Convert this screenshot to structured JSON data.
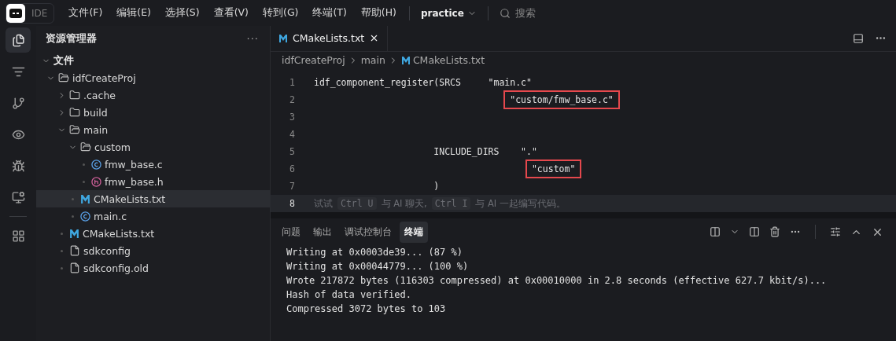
{
  "menubar": {
    "logo_label": "IDE",
    "menus": [
      "文件(F)",
      "编辑(E)",
      "选择(S)",
      "查看(V)",
      "转到(G)",
      "终端(T)",
      "帮助(H)"
    ],
    "workspace": "practice",
    "search": "搜索"
  },
  "activity_bar": [
    {
      "kind": "files",
      "selected": true
    },
    {
      "kind": "search",
      "selected": false
    },
    {
      "kind": "git",
      "selected": false
    },
    {
      "kind": "eye",
      "selected": false
    },
    {
      "kind": "bug",
      "selected": false
    },
    {
      "kind": "monitor",
      "selected": false
    },
    {
      "kind": "grid",
      "selected": false
    }
  ],
  "sidebar": {
    "title": "资源管理器",
    "more": "···",
    "section": "文件",
    "tree": [
      {
        "label": "idfCreateProj",
        "kind": "folder",
        "expanded": true,
        "selected": false,
        "children": [
          {
            "label": ".cache",
            "kind": "folder",
            "expanded": false,
            "selected": false
          },
          {
            "label": "build",
            "kind": "folder",
            "expanded": false,
            "selected": false
          },
          {
            "label": "main",
            "kind": "folder",
            "expanded": true,
            "selected": false,
            "children": [
              {
                "label": "custom",
                "kind": "folder",
                "expanded": true,
                "selected": false,
                "children": [
                  {
                    "label": "fmw_base.c",
                    "kind": "c",
                    "selected": false
                  },
                  {
                    "label": "fmw_base.h",
                    "kind": "h",
                    "selected": false
                  }
                ]
              },
              {
                "label": "CMakeLists.txt",
                "kind": "cmake",
                "selected": true
              },
              {
                "label": "main.c",
                "kind": "c",
                "selected": false
              }
            ]
          },
          {
            "label": "CMakeLists.txt",
            "kind": "cmake",
            "selected": false
          },
          {
            "label": "sdkconfig",
            "kind": "file",
            "selected": false
          },
          {
            "label": "sdkconfig.old",
            "kind": "file",
            "selected": false
          }
        ]
      }
    ]
  },
  "editor": {
    "tabs": [
      {
        "label": "CMakeLists.txt",
        "selected": true
      }
    ],
    "breadcrumb": [
      "idfCreateProj",
      "main",
      "CMakeLists.txt"
    ],
    "lines": [
      {
        "number": "1",
        "kind": "code",
        "segments": [
          {
            "text": "idf_component_register(SRCS     \"main.c\"",
            "boxed": false
          }
        ]
      },
      {
        "number": "2",
        "kind": "srcs",
        "segments": [
          {
            "text": "\"custom/fmw_base.c\"",
            "boxed": true
          }
        ]
      },
      {
        "number": "3",
        "kind": "code"
      },
      {
        "number": "4",
        "kind": "code"
      },
      {
        "number": "5",
        "kind": "code",
        "segments": [
          {
            "text": "                      INCLUDE_DIRS    \".\"",
            "boxed": false
          }
        ]
      },
      {
        "number": "6",
        "kind": "include",
        "segments": [
          {
            "text": "\"custom\"",
            "boxed": true
          }
        ]
      },
      {
        "number": "7",
        "kind": "code",
        "segments": [
          {
            "text": "                      )",
            "boxed": false
          }
        ]
      },
      {
        "number": "8",
        "kind": "hint",
        "current": true,
        "hint": [
          "试试",
          "Ctrl U",
          "与 AI 聊天,",
          "Ctrl I",
          "与 AI 一起编写代码。"
        ]
      }
    ]
  },
  "panel": {
    "tabs": [
      {
        "label": "问题",
        "selected": false
      },
      {
        "label": "输出",
        "selected": false
      },
      {
        "label": "调试控制台",
        "selected": false
      },
      {
        "label": "终端",
        "selected": true
      }
    ],
    "terminal": [
      "Writing at 0x0003de39... (87 %)",
      "Writing at 0x00044779... (100 %)",
      "Wrote 217872 bytes (116303 compressed) at 0x00010000 in 2.8 seconds (effective 627.7 kbit/s)...",
      "Hash of data verified.",
      "Compressed 3072 bytes to 103"
    ]
  }
}
